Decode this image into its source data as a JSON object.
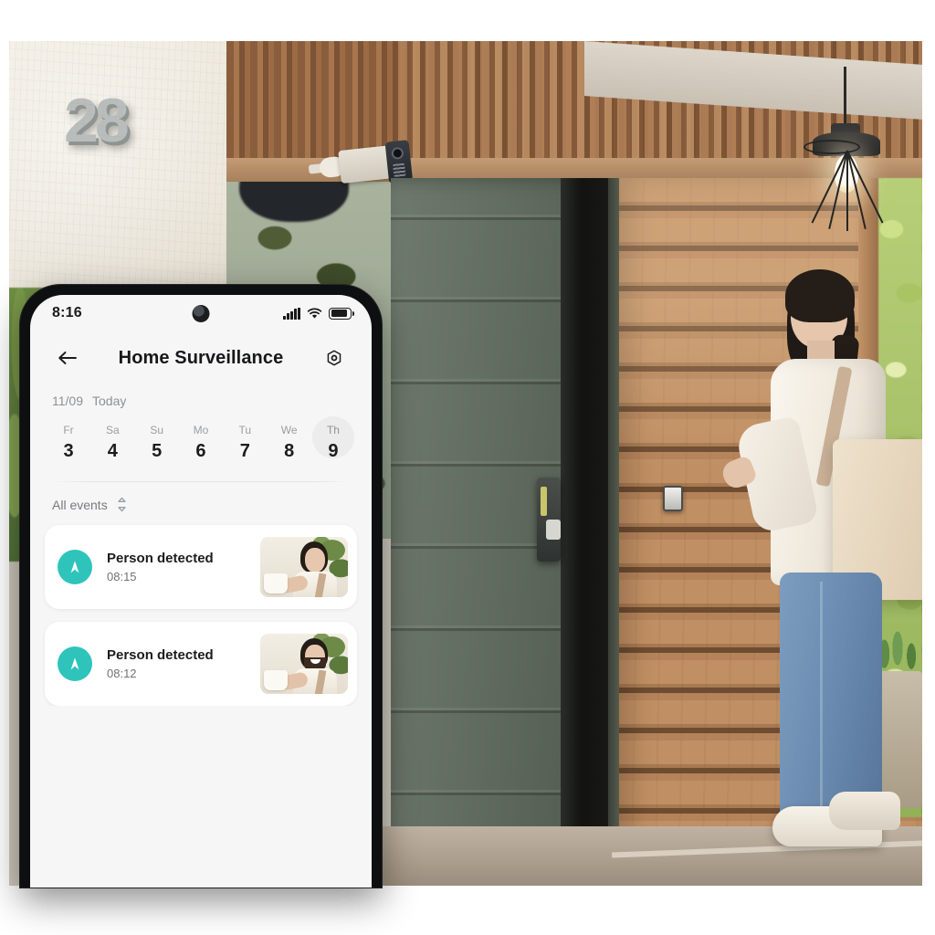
{
  "scene": {
    "house_number": "28",
    "description_icons": {
      "security_camera": "security-camera",
      "door_lock": "smart-door-lock",
      "doorbell": "video-doorbell",
      "lantern": "pendant-lantern"
    }
  },
  "phone": {
    "statusbar": {
      "time": "8:16",
      "icons": [
        "signal-icon",
        "wifi-icon",
        "battery-icon"
      ]
    },
    "appbar": {
      "back_icon": "back-arrow-icon",
      "title": "Home Surveillance",
      "settings_icon": "settings-hex-icon"
    },
    "date_header": {
      "date": "11/09",
      "today_label": "Today"
    },
    "days": [
      {
        "weekday": "Fr",
        "number": "3",
        "selected": false
      },
      {
        "weekday": "Sa",
        "number": "4",
        "selected": false
      },
      {
        "weekday": "Su",
        "number": "5",
        "selected": false
      },
      {
        "weekday": "Mo",
        "number": "6",
        "selected": false
      },
      {
        "weekday": "Tu",
        "number": "7",
        "selected": false
      },
      {
        "weekday": "We",
        "number": "8",
        "selected": false
      },
      {
        "weekday": "Th",
        "number": "9",
        "selected": true
      }
    ],
    "filter": {
      "label": "All events",
      "icon": "sort-chevrons-icon"
    },
    "events": [
      {
        "title": "Person detected",
        "time": "08:15",
        "badge_icon": "person-detected-icon",
        "thumbnail": "woman-with-cup-thumbnail"
      },
      {
        "title": "Person detected",
        "time": "08:12",
        "badge_icon": "person-detected-icon",
        "thumbnail": "man-with-cup-thumbnail"
      }
    ]
  },
  "colors": {
    "accent_teal": "#2EC4BC",
    "screen_bg": "#F6F6F6",
    "card_bg": "#FFFFFF",
    "text_primary": "#1B1C1E",
    "text_secondary": "#77797D",
    "selected_day_bg": "#ECECEC",
    "phone_bezel": "#0E0F11"
  }
}
